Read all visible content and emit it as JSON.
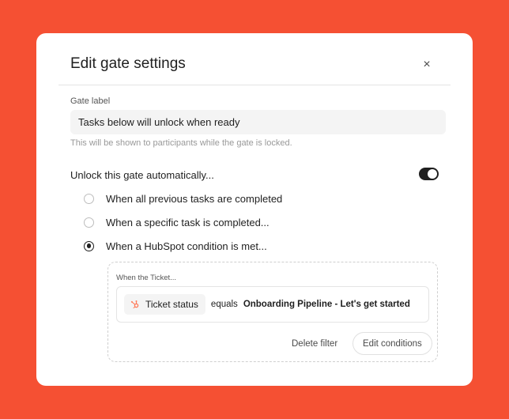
{
  "modal": {
    "title": "Edit gate settings",
    "close_glyph": "×"
  },
  "gate_label": {
    "label": "Gate label",
    "value": "Tasks below will unlock when ready",
    "hint": "This will be shown to participants while the gate is locked."
  },
  "auto_unlock": {
    "label": "Unlock this gate automatically...",
    "enabled": true,
    "options": [
      {
        "label": "When all previous tasks are completed",
        "selected": false
      },
      {
        "label": "When a specific task is completed...",
        "selected": false
      },
      {
        "label": "When a HubSpot condition is met...",
        "selected": true
      }
    ]
  },
  "condition": {
    "object_label": "When the Ticket...",
    "property": "Ticket status",
    "property_icon": "hubspot-icon",
    "operator": "equals",
    "value": "Onboarding Pipeline - Let's get started",
    "delete_label": "Delete filter",
    "edit_label": "Edit conditions"
  },
  "colors": {
    "background": "#f55033",
    "hubspot_orange": "#ff7a59",
    "toggle_on": "#1f1f1f"
  }
}
